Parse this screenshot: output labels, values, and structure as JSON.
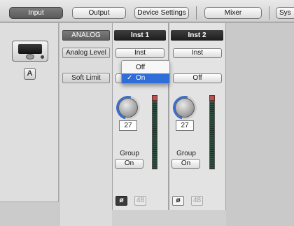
{
  "tabs": {
    "input": "Input",
    "output": "Output",
    "device_settings": "Device Settings",
    "mixer": "Mixer",
    "sys": "Sys"
  },
  "device": {
    "unit_badge": "A"
  },
  "row_labels": {
    "analog": "ANALOG",
    "analog_level": "Analog Level",
    "soft_limit": "Soft Limit"
  },
  "channels": [
    {
      "name": "Inst 1",
      "analog_level": "Inst",
      "soft_limit": "On",
      "gain": "27",
      "group_label": "Group",
      "group_value": "On",
      "phase": "ø",
      "phantom": "48"
    },
    {
      "name": "Inst 2",
      "analog_level": "Inst",
      "soft_limit": "Off",
      "gain": "27",
      "group_label": "Group",
      "group_value": "On",
      "phase": "ø",
      "phantom": "48"
    }
  ],
  "popup": {
    "options": [
      "Off",
      "On"
    ],
    "selected": "On",
    "checkmark": "✓"
  },
  "colors": {
    "accent": "#2f6ed8",
    "knob_ring": "#3a6fd0",
    "clip": "#b35454"
  }
}
